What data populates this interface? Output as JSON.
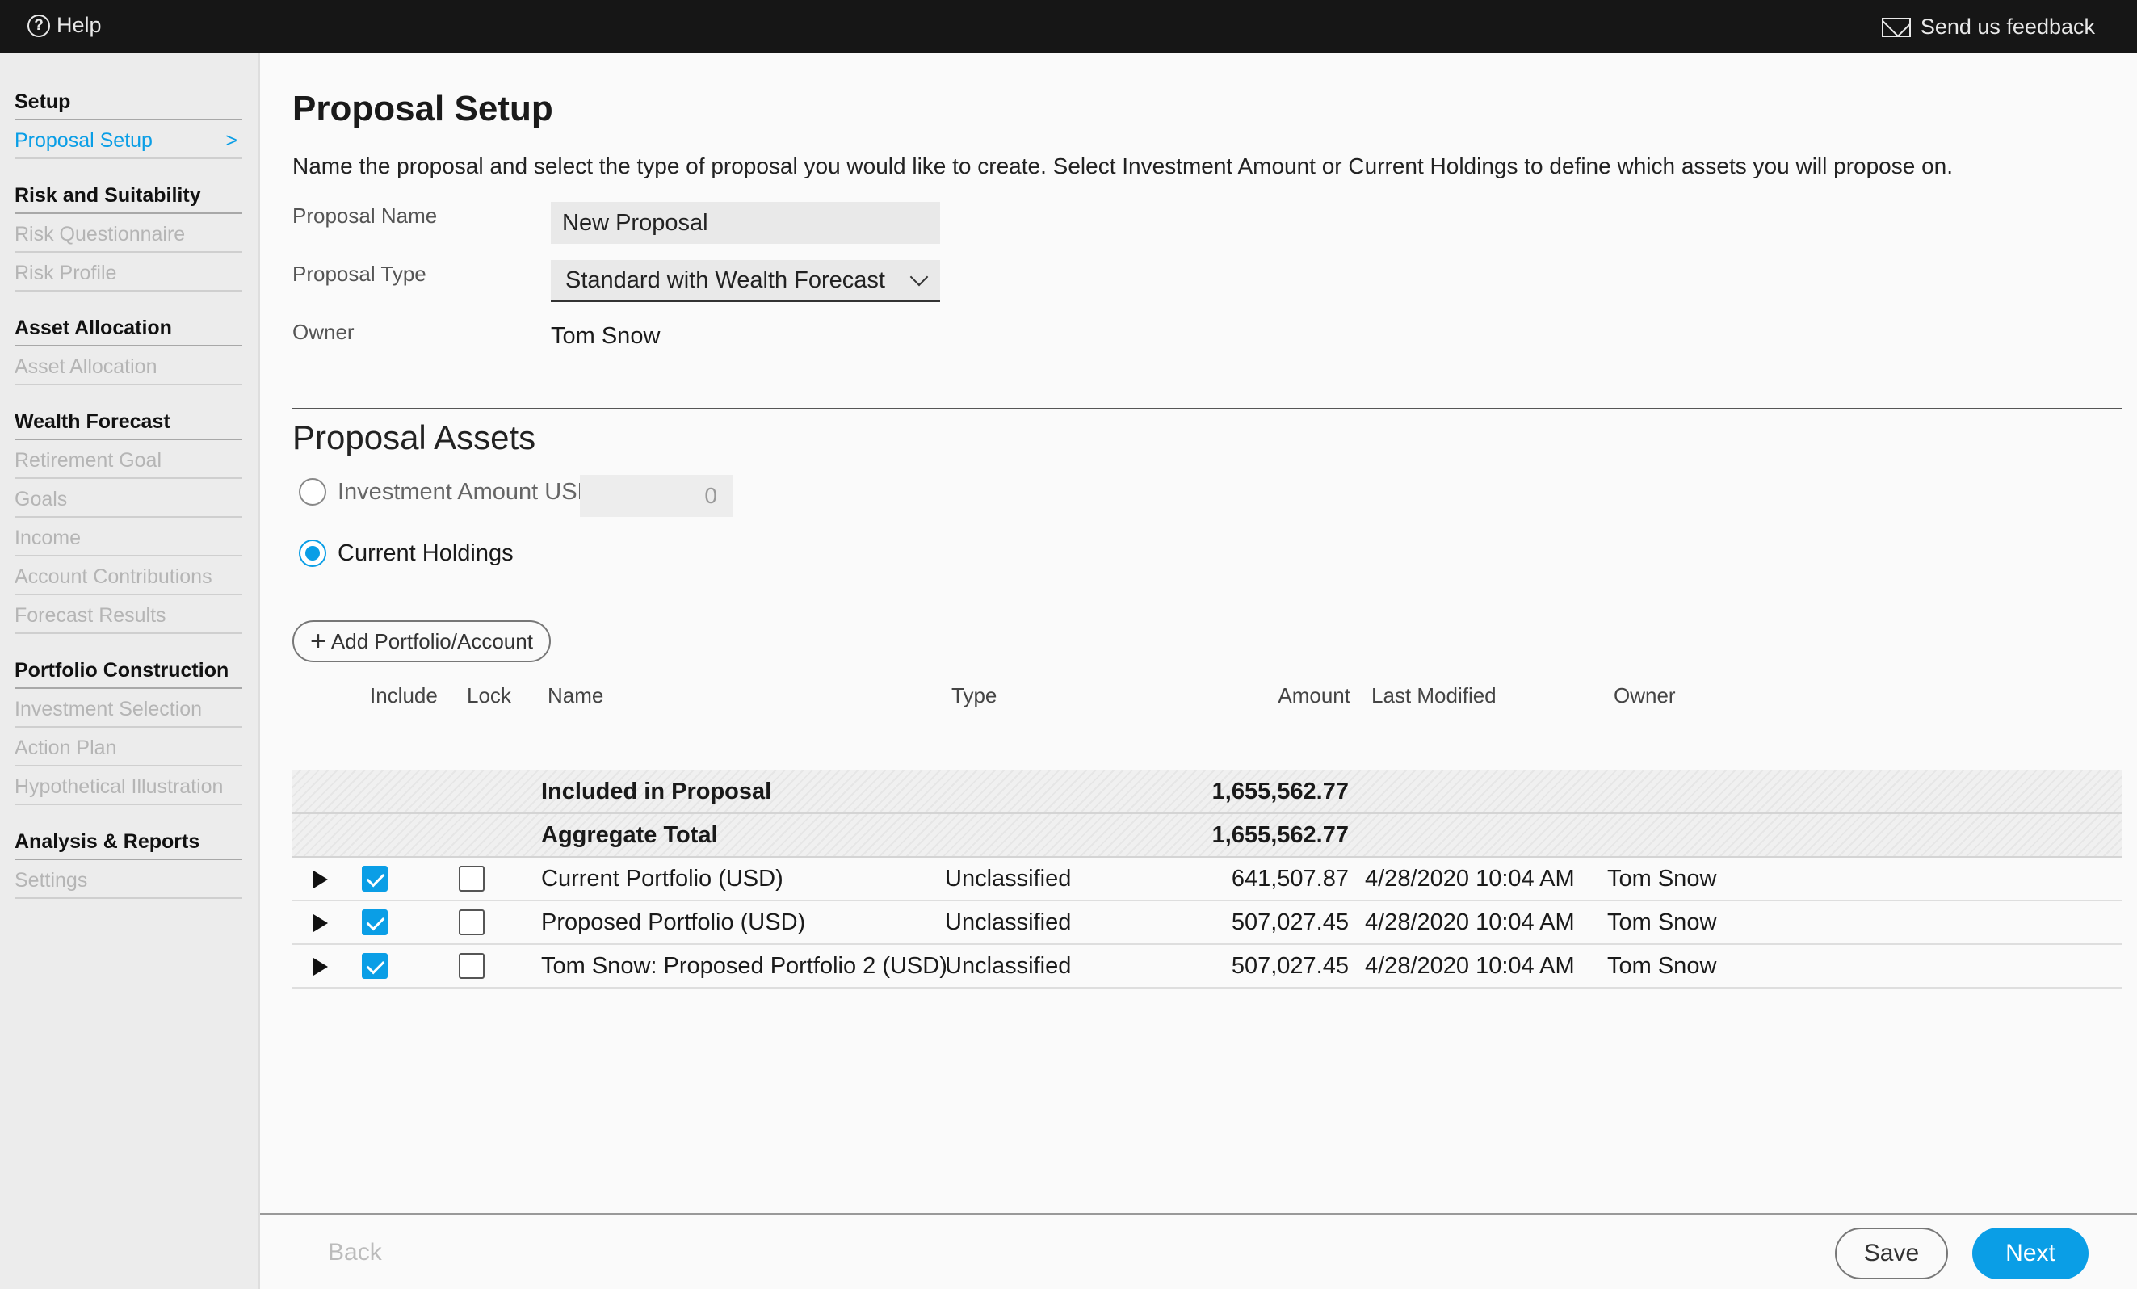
{
  "topbar": {
    "help_label": "Help",
    "help_glyph": "?",
    "feedback_label": "Send us feedback"
  },
  "sidebar": {
    "sections": [
      {
        "heading": "Setup",
        "items": [
          {
            "label": "Proposal Setup",
            "active": true,
            "chevron": ">"
          }
        ]
      },
      {
        "heading": "Risk and Suitability",
        "items": [
          {
            "label": "Risk Questionnaire"
          },
          {
            "label": "Risk Profile"
          }
        ]
      },
      {
        "heading": "Asset Allocation",
        "items": [
          {
            "label": "Asset Allocation"
          }
        ]
      },
      {
        "heading": "Wealth Forecast",
        "items": [
          {
            "label": "Retirement Goal"
          },
          {
            "label": "Goals"
          },
          {
            "label": "Income"
          },
          {
            "label": "Account Contributions"
          },
          {
            "label": "Forecast Results"
          }
        ]
      },
      {
        "heading": "Portfolio Construction",
        "items": [
          {
            "label": "Investment Selection"
          },
          {
            "label": "Action Plan"
          },
          {
            "label": "Hypothetical Illustration"
          }
        ]
      },
      {
        "heading": "Analysis & Reports",
        "items": [
          {
            "label": "Settings"
          }
        ]
      }
    ]
  },
  "main": {
    "title": "Proposal Setup",
    "description": "Name the proposal and select the type of proposal you would like to create. Select Investment Amount or Current Holdings to define which assets you will propose on.",
    "proposal_name_label": "Proposal Name",
    "proposal_name_value": "New Proposal",
    "proposal_type_label": "Proposal Type",
    "proposal_type_value": "Standard with Wealth Forecast",
    "owner_label": "Owner",
    "owner_value": "Tom Snow"
  },
  "assets": {
    "title": "Proposal Assets",
    "investment_amount_label": "Investment Amount USD",
    "investment_amount_value": "0",
    "current_holdings_label": "Current Holdings",
    "selected_option": "current_holdings",
    "add_button_glyph": "+",
    "add_button_label": "Add Portfolio/Account"
  },
  "table": {
    "headers": {
      "include": "Include",
      "lock": "Lock",
      "name": "Name",
      "type": "Type",
      "amount": "Amount",
      "last_modified": "Last Modified",
      "owner": "Owner"
    },
    "summary": [
      {
        "label": "Included in Proposal",
        "amount": "1,655,562.77"
      },
      {
        "label": "Aggregate Total",
        "amount": "1,655,562.77"
      }
    ],
    "rows": [
      {
        "name": "Current Portfolio (USD)",
        "type": "Unclassified",
        "amount": "641,507.87",
        "last_modified": "4/28/2020 10:04 AM",
        "owner": "Tom Snow",
        "include": true,
        "lock": false
      },
      {
        "name": "Proposed Portfolio (USD)",
        "type": "Unclassified",
        "amount": "507,027.45",
        "last_modified": "4/28/2020 10:04 AM",
        "owner": "Tom Snow",
        "include": true,
        "lock": false
      },
      {
        "name": "Tom Snow: Proposed Portfolio 2 (USD)",
        "type": "Unclassified",
        "amount": "507,027.45",
        "last_modified": "4/28/2020 10:04 AM",
        "owner": "Tom Snow",
        "include": true,
        "lock": false
      }
    ]
  },
  "footer": {
    "back_label": "Back",
    "save_label": "Save",
    "next_label": "Next"
  },
  "colors": {
    "accent": "#0a9ee6",
    "topbar": "#161616",
    "sidebar": "#ececec"
  }
}
